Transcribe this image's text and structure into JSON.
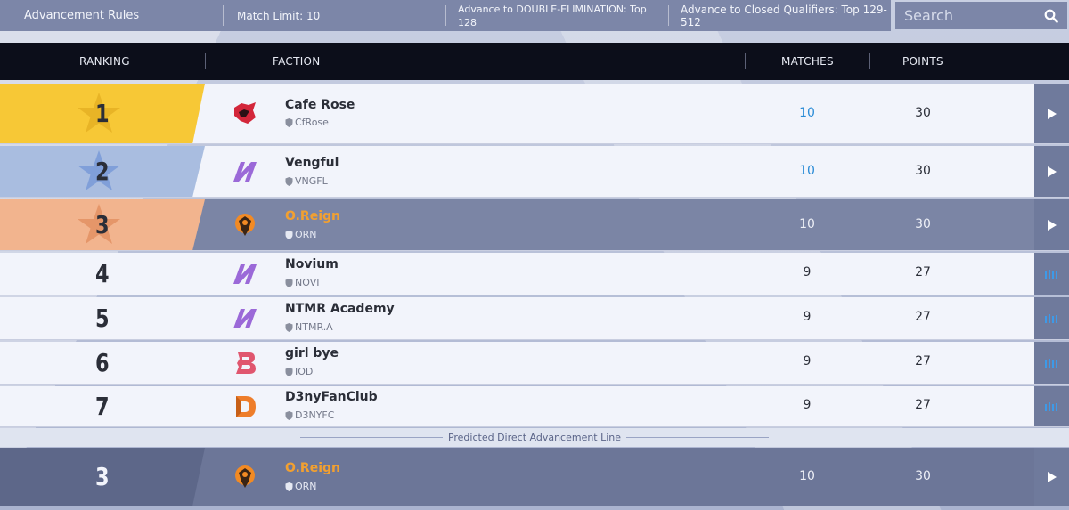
{
  "topbar": {
    "rules": "Advancement Rules",
    "match_limit": "Match Limit: 10",
    "double_elim": "Advance to DOUBLE-ELIMINATION: Top 128",
    "closed_qualifiers": "Advance to Closed Qualifiers: Top 129-512"
  },
  "search": {
    "placeholder": "Search",
    "icon": "search-icon"
  },
  "header": {
    "ranking": "RANKING",
    "faction": "FACTION",
    "matches": "MATCHES",
    "points": "POINTS"
  },
  "rows": [
    {
      "rank": "1",
      "name": "Cafe Rose",
      "tag": "CfRose",
      "matches": "10",
      "points": "30",
      "logo": "cafe-rose-logo",
      "tier": "gold",
      "action": "play-icon"
    },
    {
      "rank": "2",
      "name": "Vengful",
      "tag": "VNGFL",
      "matches": "10",
      "points": "30",
      "logo": "vengful-logo",
      "tier": "silver",
      "action": "play-icon"
    },
    {
      "rank": "3",
      "name": "O.Reign",
      "tag": "ORN",
      "matches": "10",
      "points": "30",
      "logo": "oreign-logo",
      "tier": "bronze",
      "action": "play-icon"
    },
    {
      "rank": "4",
      "name": "Novium",
      "tag": "NOVI",
      "matches": "9",
      "points": "27",
      "logo": "novium-logo",
      "action": "bars-icon"
    },
    {
      "rank": "5",
      "name": "NTMR Academy",
      "tag": "NTMR.A",
      "matches": "9",
      "points": "27",
      "logo": "ntmr-logo",
      "action": "bars-icon"
    },
    {
      "rank": "6",
      "name": "girl bye",
      "tag": "IOD",
      "matches": "9",
      "points": "27",
      "logo": "girl-bye-logo",
      "action": "bars-icon"
    },
    {
      "rank": "7",
      "name": "D3nyFanClub",
      "tag": "D3NYFC",
      "matches": "9",
      "points": "27",
      "logo": "d3ny-logo",
      "action": "bars-icon"
    }
  ],
  "advancement_line": "Predicted Direct Advancement Line",
  "my_row": {
    "rank": "3",
    "name": "O.Reign",
    "tag": "ORN",
    "matches": "10",
    "points": "30"
  },
  "colors": {
    "gold": "#f7c836",
    "silver": "#a9bde0",
    "bronze": "#f2b48e",
    "highlight": "#7b85a5",
    "accent_blue": "#2a8bd6",
    "accent_orange": "#f2a030"
  }
}
